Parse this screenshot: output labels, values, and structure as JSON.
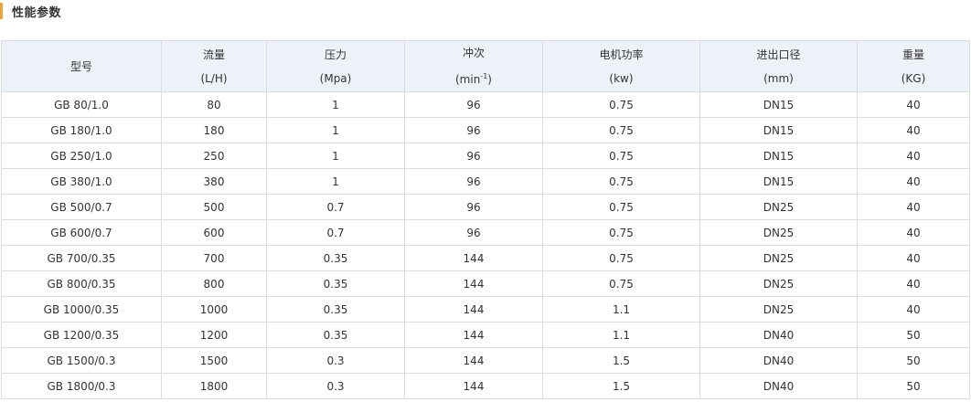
{
  "section": {
    "title": "性能参数",
    "accent_color": "#f0a23b"
  },
  "table": {
    "header_bg": "#edf2f9",
    "columns": [
      {
        "name": "型号",
        "unit": ""
      },
      {
        "name": "流量",
        "unit": "(L/H)"
      },
      {
        "name": "压力",
        "unit": "(Mpa)"
      },
      {
        "name": "冲次",
        "unit_pre": "(min",
        "unit_sup": "-1",
        "unit_post": ")"
      },
      {
        "name": "电机功率",
        "unit": "(kw)"
      },
      {
        "name": "进出口径",
        "unit": "(mm)"
      },
      {
        "name": "重量",
        "unit": "(KG)"
      }
    ],
    "rows": [
      [
        "GB 80/1.0",
        "80",
        "1",
        "96",
        "0.75",
        "DN15",
        "40"
      ],
      [
        "GB 180/1.0",
        "180",
        "1",
        "96",
        "0.75",
        "DN15",
        "40"
      ],
      [
        "GB 250/1.0",
        "250",
        "1",
        "96",
        "0.75",
        "DN15",
        "40"
      ],
      [
        "GB 380/1.0",
        "380",
        "1",
        "96",
        "0.75",
        "DN15",
        "40"
      ],
      [
        "GB 500/0.7",
        "500",
        "0.7",
        "96",
        "0.75",
        "DN25",
        "40"
      ],
      [
        "GB 600/0.7",
        "600",
        "0.7",
        "96",
        "0.75",
        "DN25",
        "40"
      ],
      [
        "GB 700/0.35",
        "700",
        "0.35",
        "144",
        "0.75",
        "DN25",
        "40"
      ],
      [
        "GB 800/0.35",
        "800",
        "0.35",
        "144",
        "0.75",
        "DN25",
        "40"
      ],
      [
        "GB 1000/0.35",
        "1000",
        "0.35",
        "144",
        "1.1",
        "DN25",
        "40"
      ],
      [
        "GB 1200/0.35",
        "1200",
        "0.35",
        "144",
        "1.1",
        "DN40",
        "50"
      ],
      [
        "GB 1500/0.3",
        "1500",
        "0.3",
        "144",
        "1.5",
        "DN40",
        "50"
      ],
      [
        "GB 1800/0.3",
        "1800",
        "0.3",
        "144",
        "1.5",
        "DN40",
        "50"
      ]
    ]
  }
}
